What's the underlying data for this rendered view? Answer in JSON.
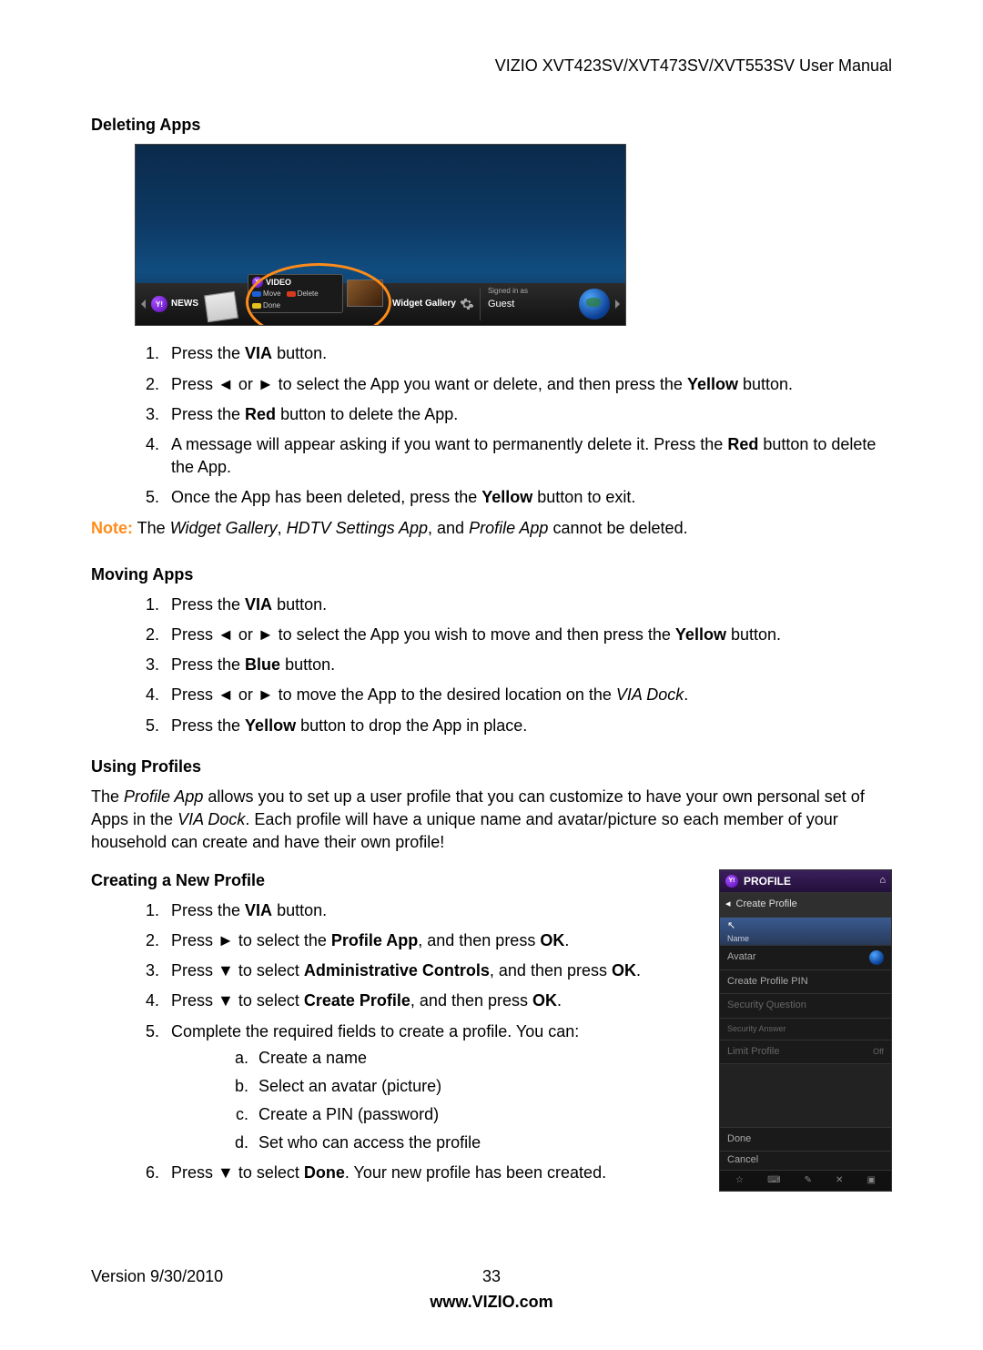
{
  "header": {
    "title": "VIZIO XVT423SV/XVT473SV/XVT553SV User Manual"
  },
  "sections": {
    "deleting_apps": {
      "heading": "Deleting Apps",
      "screenshot": {
        "news_label": "NEWS",
        "video_label": "VIDEO",
        "move_label": "Move",
        "delete_label": "Delete",
        "done_label": "Done",
        "gallery_label": "Widget Gallery",
        "signed_label": "Signed in as",
        "guest_label": "Guest"
      },
      "steps": [
        {
          "pre": "Press the ",
          "bold": "VIA",
          "post": " button."
        },
        {
          "html": "Press ◄ or ► to select the App you want or delete, and then press the <b>Yellow</b> button."
        },
        {
          "html": "Press the <b>Red</b> button to delete the App."
        },
        {
          "html": "A message will appear asking if you want to permanently delete it. Press the <b>Red</b> button to delete the App."
        },
        {
          "html": "Once the App has been deleted, press the <b>Yellow</b> button to exit."
        }
      ],
      "note_label": "Note:",
      "note_text": " The <i>Widget Gallery</i>, <i>HDTV Settings App</i>, and <i>Profile App</i> cannot be deleted."
    },
    "moving_apps": {
      "heading": "Moving Apps",
      "steps": [
        {
          "html": "Press the <b>VIA</b> button."
        },
        {
          "html": "Press ◄ or ► to select the App you wish to move and then press the <b>Yellow</b> button."
        },
        {
          "html": "Press the <b>Blue</b> button."
        },
        {
          "html": "Press ◄ or ► to move the App to the desired location on the <i>VIA Dock</i>."
        },
        {
          "html": "Press the <b>Yellow</b> button to drop the App in place."
        }
      ]
    },
    "using_profiles": {
      "heading": "Using Profiles",
      "intro": "The <i>Profile App</i> allows you to set up a user profile that you can customize to have your own personal set of Apps in the <i>VIA Dock</i>. Each profile will have a unique name and avatar/picture so each member of your household can create and have their own profile!"
    },
    "creating_profile": {
      "heading": "Creating a New Profile",
      "steps": [
        {
          "html": "Press the <b>VIA</b> button."
        },
        {
          "html": "Press ► to select the <b>Profile App</b>, and then press <b>OK</b>."
        },
        {
          "html": "Press ▼ to select <b>Administrative Controls</b>, and then press <b>OK</b>."
        },
        {
          "html": "Press ▼ to select <b>Create Profile</b>, and then press <b>OK</b>."
        },
        {
          "html": "Complete the required fields to create a profile. You can:",
          "sub": [
            "Create a name",
            "Select an avatar (picture)",
            "Create a PIN (password)",
            "Set who can access the profile"
          ]
        },
        {
          "html": "Press ▼ to select <b>Done</b>. Your new profile has been created."
        }
      ],
      "profile_shot": {
        "title": "PROFILE",
        "create": "Create Profile",
        "name": "Name",
        "avatar": "Avatar",
        "pin": "Create Profile PIN",
        "question": "Security Question",
        "answer": "Security Answer",
        "limit": "Limit Profile",
        "limit_val": "Off",
        "done": "Done",
        "cancel": "Cancel"
      }
    }
  },
  "footer": {
    "version": "Version 9/30/2010",
    "page": "33",
    "site": "www.VIZIO.com"
  }
}
